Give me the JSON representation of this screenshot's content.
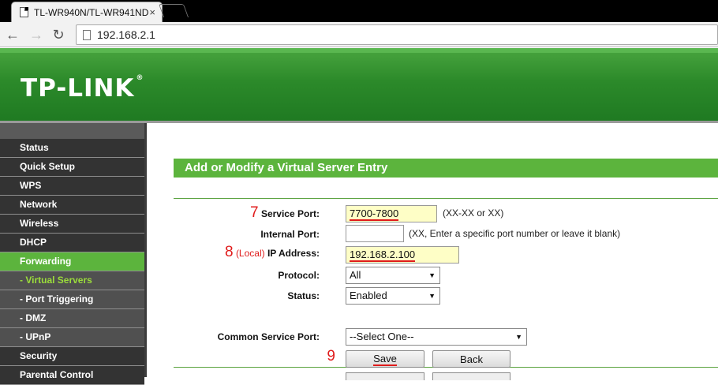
{
  "browser": {
    "tab_title": "TL-WR940N/TL-WR941ND",
    "tab_close": "×",
    "address": "192.168.2.1",
    "back_glyph": "←",
    "forward_glyph": "→",
    "reload_glyph": "↻"
  },
  "header": {
    "logo_text": "TP-LINK",
    "logo_mark": "®"
  },
  "sidebar": {
    "items": [
      {
        "label": "Status"
      },
      {
        "label": "Quick Setup"
      },
      {
        "label": "WPS"
      },
      {
        "label": "Network"
      },
      {
        "label": "Wireless"
      },
      {
        "label": "DHCP"
      },
      {
        "label": "Forwarding"
      },
      {
        "label": "- Virtual Servers"
      },
      {
        "label": "- Port Triggering"
      },
      {
        "label": "- DMZ"
      },
      {
        "label": "- UPnP"
      },
      {
        "label": "Security"
      },
      {
        "label": "Parental Control"
      }
    ]
  },
  "form": {
    "section_title": "Add or Modify a Virtual Server Entry",
    "service_port": {
      "step": "7",
      "label": "Service Port:",
      "value": "7700-7800",
      "hint": "(XX-XX or XX)"
    },
    "internal_port": {
      "label": "Internal Port:",
      "value": "",
      "hint": "(XX, Enter a specific port number or leave it blank)"
    },
    "ip_address": {
      "step": "8",
      "local_tag": "(Local)",
      "label": "IP Address:",
      "value": "192.168.2.100"
    },
    "protocol": {
      "label": "Protocol:",
      "value": "All"
    },
    "status": {
      "label": "Status:",
      "value": "Enabled"
    },
    "common_service_port": {
      "label": "Common Service Port:",
      "value": "--Select One--"
    },
    "save": {
      "step": "9",
      "label": "Save"
    },
    "back": {
      "label": "Back"
    },
    "dropdown_arrow": "▼"
  },
  "colors": {
    "brand_green": "#5cb43d",
    "annotation_red": "#e01b1b",
    "highlight_yellow": "#fefec6"
  }
}
